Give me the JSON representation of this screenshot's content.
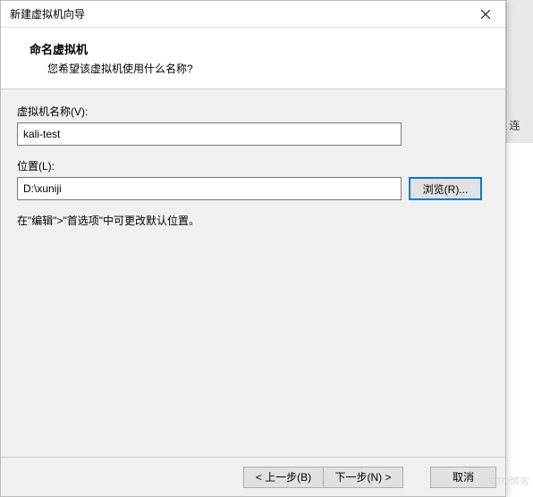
{
  "dialog": {
    "title": "新建虚拟机向导",
    "header_title": "命名虚拟机",
    "header_sub": "您希望该虚拟机使用什么名称?",
    "name_label": "虚拟机名称(V):",
    "name_value": "kali-test",
    "location_label": "位置(L):",
    "location_value": "D:\\xuniji",
    "browse_label": "浏览(R)...",
    "hint": "在\"编辑\">\"首选项\"中可更改默认位置。",
    "back_label": "< 上一步(B)",
    "next_label": "下一步(N) >",
    "cancel_label": "取消"
  },
  "background": {
    "side_text": "连"
  },
  "watermark": "CTO博客"
}
